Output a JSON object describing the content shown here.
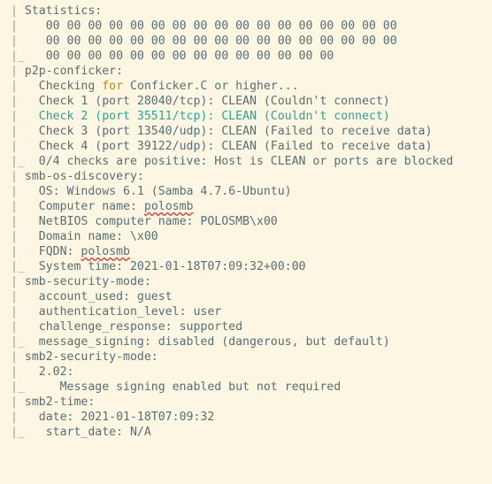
{
  "terminal": {
    "background_color": "#fdf6e3",
    "text_color": "#586e75",
    "gutter_color": "#93a1a1",
    "highlight_color": "#2aa198",
    "keyword_color": "#b58900",
    "spellcheck_underline_color": "#dc322f",
    "lines": [
      {
        "gutter": "|",
        "text": " Statistics:"
      },
      {
        "gutter": "|",
        "text": "    00 00 00 00 00 00 00 00 00 00 00 00 00 00 00 00 00"
      },
      {
        "gutter": "|",
        "text": "    00 00 00 00 00 00 00 00 00 00 00 00 00 00 00 00 00"
      },
      {
        "gutter": "|_",
        "text": "   00 00 00 00 00 00 00 00 00 00 00 00 00 00"
      },
      {
        "gutter": "|",
        "text": " p2p-conficker:"
      },
      {
        "gutter": "|",
        "text": "   Checking ",
        "keyword": "for",
        "text_after": " Conficker.C or higher..."
      },
      {
        "gutter": "|",
        "text": "   Check 1 (port 28040/tcp): CLEAN (Couldn't connect)"
      },
      {
        "gutter": "|",
        "text": "   Check 2 (port 35511/tcp): CLEAN (Couldn't connect)",
        "style": "teal"
      },
      {
        "gutter": "|",
        "text": "   Check 3 (port 13540/udp): CLEAN (Failed to receive data)"
      },
      {
        "gutter": "|",
        "text": "   Check 4 (port 39122/udp): CLEAN (Failed to receive data)"
      },
      {
        "gutter": "|_",
        "text": "  0/4 checks are positive: Host is CLEAN or ports are blocked"
      },
      {
        "gutter": "|",
        "text": " smb-os-discovery:"
      },
      {
        "gutter": "|",
        "text": "   OS: Windows 6.1 (Samba 4.7.6-Ubuntu)"
      },
      {
        "gutter": "|",
        "text": "   Computer name: ",
        "spellcheck": "polosmb"
      },
      {
        "gutter": "|",
        "text": "   NetBIOS computer name: POLOSMB\\x00"
      },
      {
        "gutter": "|",
        "text": "   Domain name: \\x00"
      },
      {
        "gutter": "|",
        "text": "   FQDN: ",
        "spellcheck": "polosmb"
      },
      {
        "gutter": "|_",
        "text": "  System time: 2021-01-18T07:09:32+00:00"
      },
      {
        "gutter": "|",
        "text": " smb-security-mode:"
      },
      {
        "gutter": "|",
        "text": "   account_used: guest"
      },
      {
        "gutter": "|",
        "text": "   authentication_level: user"
      },
      {
        "gutter": "|",
        "text": "   challenge_response: supported"
      },
      {
        "gutter": "|_",
        "text": "  message_signing: disabled (dangerous, but default)"
      },
      {
        "gutter": "|",
        "text": " smb2-security-mode:"
      },
      {
        "gutter": "|",
        "text": "   2.02:"
      },
      {
        "gutter": "|_",
        "text": "     Message signing enabled but not required"
      },
      {
        "gutter": "|",
        "text": " smb2-time:"
      },
      {
        "gutter": "|",
        "text": "   date: 2021-01-18T07:09:32"
      },
      {
        "gutter": "|_",
        "text": "   start_date: N/A"
      }
    ]
  }
}
